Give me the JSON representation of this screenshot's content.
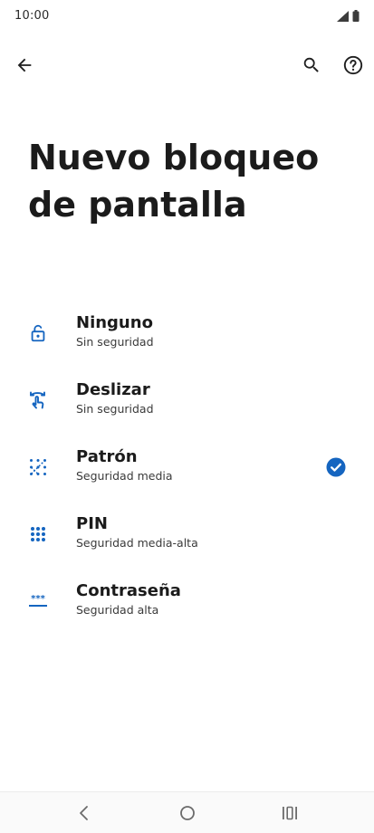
{
  "status_bar": {
    "time": "10:00"
  },
  "top_bar": {
    "back_icon": "arrow-left-icon",
    "search_icon": "search-icon",
    "help_icon": "help-circle-icon"
  },
  "page": {
    "title": "Nuevo bloqueo de pantalla"
  },
  "options": [
    {
      "title": "Ninguno",
      "subtitle": "Sin seguridad",
      "icon": "unlocked-padlock-icon",
      "selected": false
    },
    {
      "title": "Deslizar",
      "subtitle": "Sin seguridad",
      "icon": "swipe-icon",
      "selected": false
    },
    {
      "title": "Patrón",
      "subtitle": "Seguridad media",
      "icon": "pattern-icon",
      "selected": true
    },
    {
      "title": "PIN",
      "subtitle": "Seguridad media-alta",
      "icon": "pin-keypad-icon",
      "selected": false
    },
    {
      "title": "Contraseña",
      "subtitle": "Seguridad alta",
      "icon": "password-icon",
      "selected": false
    }
  ],
  "nav_bar": {
    "back_icon": "nav-back-icon",
    "home_icon": "nav-home-icon",
    "recents_icon": "nav-recents-icon"
  },
  "colors": {
    "accent": "#1565c0",
    "text_primary": "#1b1b1b",
    "text_secondary": "#3a3a3a",
    "background": "#ffffff"
  }
}
